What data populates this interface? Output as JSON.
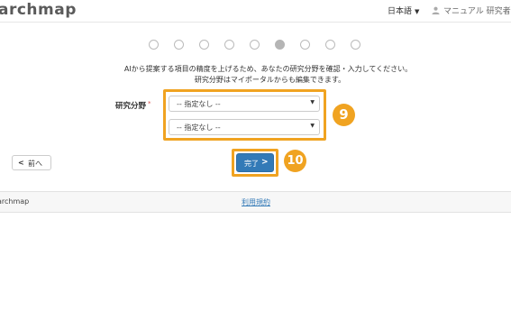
{
  "header": {
    "logo": "archmap",
    "language": "日本語",
    "user": "マニュアル 研究者"
  },
  "steps": {
    "total": 9,
    "current": 6
  },
  "instructions": {
    "line1": "AIから提案する項目の精度を上げるため、あなたの研究分野を確認・入力してください。",
    "line2": "研究分野はマイポータルからも編集できます。"
  },
  "form": {
    "field_label": "研究分野",
    "required_mark": "*",
    "select1": "-- 指定なし --",
    "select2": "-- 指定なし --"
  },
  "annotations": {
    "badge_select": "9",
    "badge_done": "10"
  },
  "buttons": {
    "back_chevron": "<",
    "back_label": "前へ",
    "done_label": "完了",
    "done_chevron": ">"
  },
  "footer": {
    "brand": "archmap",
    "terms": "利用規約"
  },
  "colors": {
    "highlight": "#f0a321",
    "primary": "#337ab7"
  }
}
